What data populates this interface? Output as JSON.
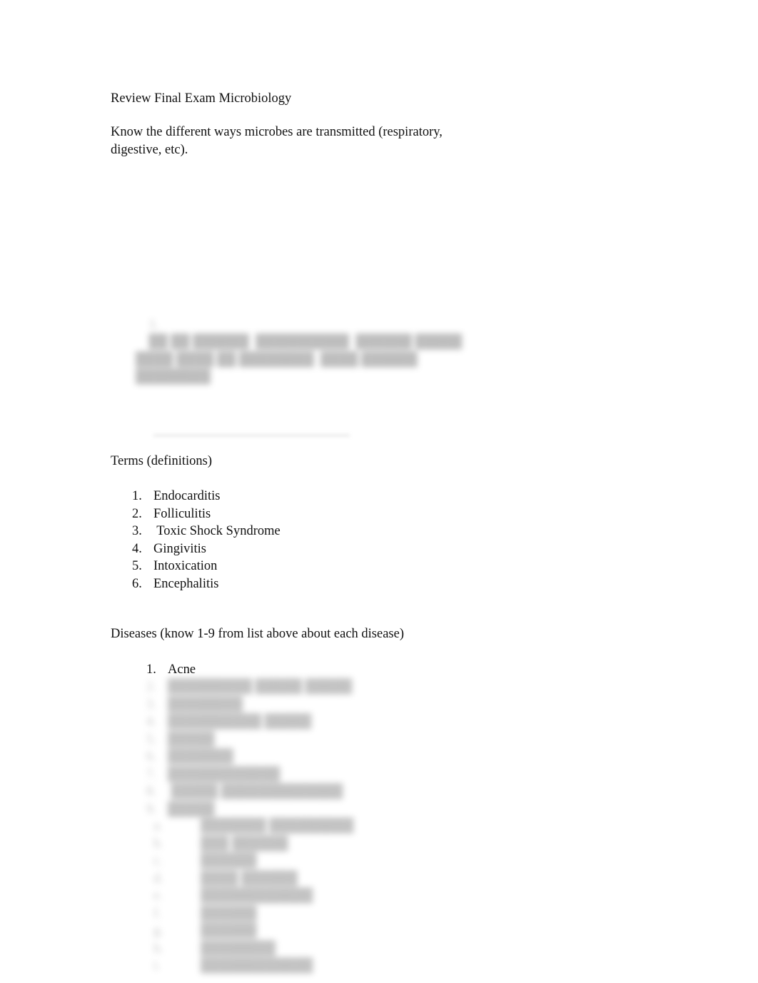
{
  "document": {
    "title": "Review Final Exam Microbiology",
    "intro_paragraph": "Know the different ways microbes are transmitted (respiratory, digestive, etc).",
    "redacted_paragraph": {
      "marker": "1.",
      "text": "██ ██ ██████  ██████████  ██████ █████ ████ ████ ██ ████████  ████ ██████ ████████"
    },
    "terms": {
      "heading": "Terms (definitions)",
      "items": [
        {
          "marker": "1.",
          "label": "Endocarditis"
        },
        {
          "marker": "2.",
          "label": "Folliculitis"
        },
        {
          "marker": "3.",
          "label": " Toxic Shock Syndrome"
        },
        {
          "marker": "4.",
          "label": "Gingivitis"
        },
        {
          "marker": "5.",
          "label": "Intoxication"
        },
        {
          "marker": "6.",
          "label": "Encephalitis"
        }
      ]
    },
    "diseases": {
      "heading": "Diseases (know 1-9 from list above about each disease)",
      "items": [
        {
          "marker": "1.",
          "label": "Acne"
        }
      ],
      "redacted_items_upper": [
        {
          "marker": "2.",
          "label": "█████████ █████ █████"
        },
        {
          "marker": "3.",
          "label": "████████"
        },
        {
          "marker": "4.",
          "label": "██████████ █████"
        },
        {
          "marker": "5.",
          "label": "█████"
        },
        {
          "marker": "6.",
          "label": "███████"
        },
        {
          "marker": "7.",
          "label": "████████████"
        },
        {
          "marker": "8.",
          "label": " █████ █████████████"
        },
        {
          "marker": "9.",
          "label": "█████"
        }
      ],
      "redacted_items_lower": [
        {
          "marker": "a.",
          "label": "███████ █████████"
        },
        {
          "marker": "b.",
          "label": "███ ██████"
        },
        {
          "marker": "c.",
          "label": "██████"
        },
        {
          "marker": "d.",
          "label": "████ ██████"
        },
        {
          "marker": "e.",
          "label": "████████████"
        },
        {
          "marker": "f.",
          "label": "██████"
        },
        {
          "marker": "g.",
          "label": "██████"
        },
        {
          "marker": "h.",
          "label": "████████"
        },
        {
          "marker": "i.",
          "label": "████████████"
        }
      ]
    }
  }
}
